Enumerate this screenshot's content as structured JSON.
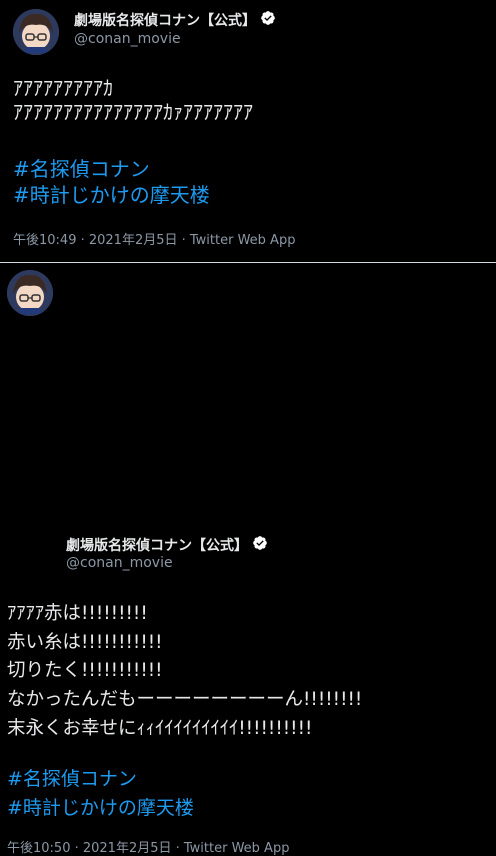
{
  "tweets": [
    {
      "display_name": "劇場版名探偵コナン【公式】",
      "handle": "@conan_movie",
      "text": "ｱｱｱｱｱｱｱｱｱｶ\nｱｱｱｱｱｱｱｱｱｱｱｱｱｱｱｶｧｱｱｱｱｱｱｱ",
      "hashtags": [
        "#名探偵コナン",
        "#時計じかけの摩天楼"
      ],
      "meta": "午後10:49 · 2021年2月5日 · Twitter Web App"
    },
    {
      "display_name": "劇場版名探偵コナン【公式】",
      "handle": "@conan_movie",
      "text": "ｱｱｱｱ赤は!!!!!!!!!\n赤い糸は!!!!!!!!!!!\n切りたく!!!!!!!!!!!\nなかったんだもーーーーーーーーん!!!!!!!!\n末永くお幸せにｨｨｲｲｲｲｲｲｲｲｲ!!!!!!!!!!",
      "hashtags": [
        "#名探偵コナン",
        "#時計じかけの摩天楼"
      ],
      "meta": "午後10:50 · 2021年2月5日 · Twitter Web App"
    }
  ],
  "colors": {
    "background": "#000000",
    "text": "#e7e9ea",
    "secondary": "#8b98a5",
    "hashtag": "#1d9bf0",
    "verified_badge": "#ffffff"
  }
}
